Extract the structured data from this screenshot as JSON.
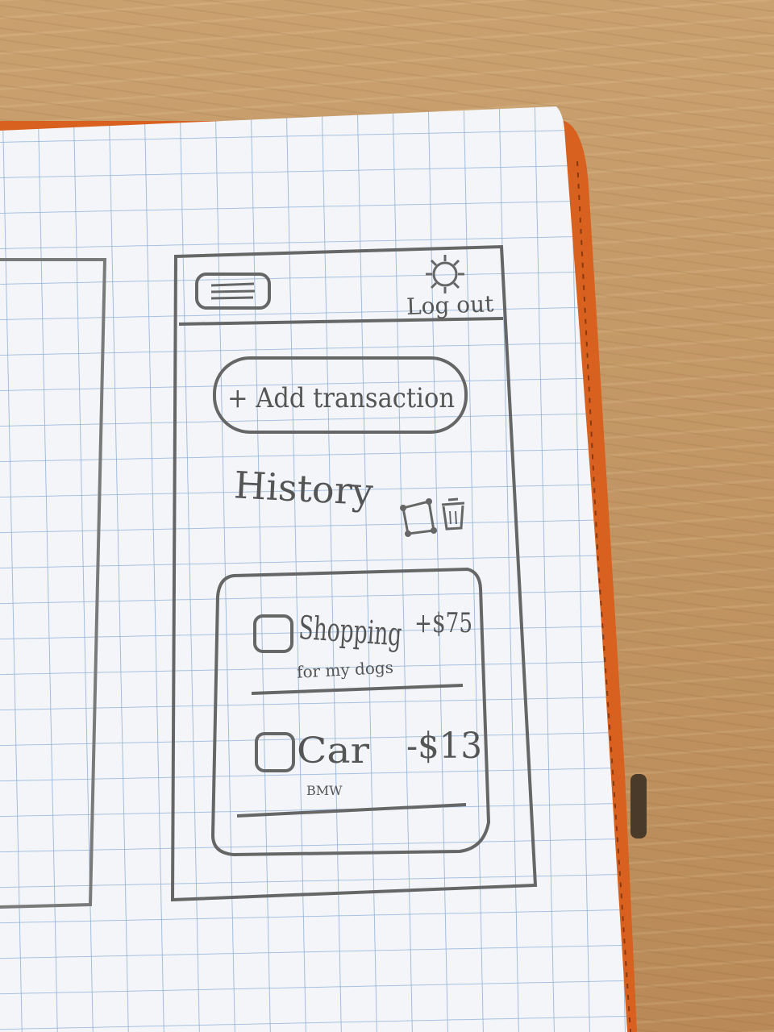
{
  "header": {
    "menu_icon": "hamburger-menu-icon",
    "settings_icon": "gear-icon",
    "logout_label": "Log out"
  },
  "actions": {
    "add_transaction_label": "+ Add transaction"
  },
  "history": {
    "title": "History",
    "select_icon": "resize-select-icon",
    "delete_icon": "trash-icon",
    "transactions": [
      {
        "title": "Shopping",
        "subtitle": "for my dogs",
        "amount": "+$75"
      },
      {
        "title": "Car",
        "subtitle": "BMW",
        "amount": "-$13"
      }
    ]
  },
  "colors": {
    "pencil": "#5a5a5a",
    "paper": "#f4f6f8",
    "grid": "#8fb0d8",
    "cover": "#d8611f"
  }
}
